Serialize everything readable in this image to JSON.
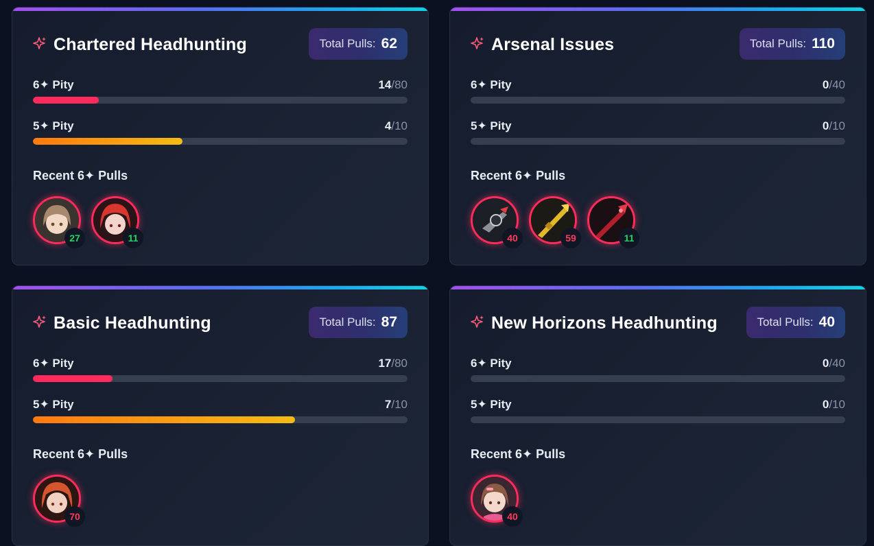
{
  "cards": [
    {
      "title": "Chartered Headhunting",
      "total_label": "Total Pulls:",
      "total_value": "62",
      "six_pity": {
        "label": "6✦ Pity",
        "current": "14",
        "max": "/80",
        "fill": 0.175
      },
      "five_pity": {
        "label": "5✦ Pity",
        "current": "4",
        "max": "/10",
        "fill": 0.4
      },
      "recent_label": "Recent 6✦ Pulls",
      "pulls": [
        {
          "count": "27",
          "count_color": "green"
        },
        {
          "count": "11",
          "count_color": "green"
        }
      ]
    },
    {
      "title": "Arsenal Issues",
      "total_label": "Total Pulls:",
      "total_value": "110",
      "six_pity": {
        "label": "6✦ Pity",
        "current": "0",
        "max": "/40",
        "fill": 0
      },
      "five_pity": {
        "label": "5✦ Pity",
        "current": "0",
        "max": "/10",
        "fill": 0
      },
      "recent_label": "Recent 6✦ Pulls",
      "pulls": [
        {
          "count": "40",
          "count_color": "red"
        },
        {
          "count": "59",
          "count_color": "red"
        },
        {
          "count": "11",
          "count_color": "green"
        }
      ]
    },
    {
      "title": "Basic Headhunting",
      "total_label": "Total Pulls:",
      "total_value": "87",
      "six_pity": {
        "label": "6✦ Pity",
        "current": "17",
        "max": "/80",
        "fill": 0.2125
      },
      "five_pity": {
        "label": "5✦ Pity",
        "current": "7",
        "max": "/10",
        "fill": 0.7
      },
      "recent_label": "Recent 6✦ Pulls",
      "pulls": [
        {
          "count": "70",
          "count_color": "red"
        }
      ]
    },
    {
      "title": "New Horizons Headhunting",
      "total_label": "Total Pulls:",
      "total_value": "40",
      "six_pity": {
        "label": "6✦ Pity",
        "current": "0",
        "max": "/40",
        "fill": 0
      },
      "five_pity": {
        "label": "5✦ Pity",
        "current": "0",
        "max": "/10",
        "fill": 0
      },
      "recent_label": "Recent 6✦ Pulls",
      "pulls": [
        {
          "count": "40",
          "count_color": "red"
        }
      ]
    }
  ],
  "colors": {
    "accent_pink": "#ff2b5c",
    "count_green": "#25d366",
    "count_red": "#ff3b5c",
    "header_gradient": [
      "#a54ff0",
      "#12d2e4"
    ]
  },
  "icons": {
    "banner": "sparkle-icon"
  }
}
